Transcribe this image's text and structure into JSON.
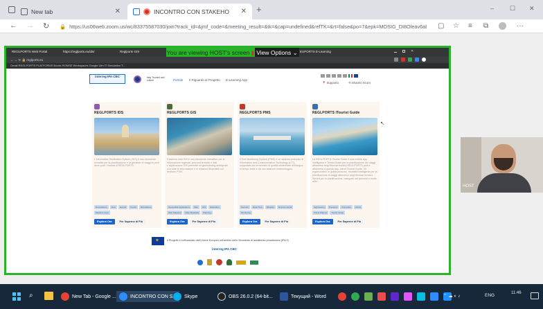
{
  "browser": {
    "tabs": [
      {
        "label": "New tab"
      },
      {
        "label": "INCONTRO CON STAKEHO"
      }
    ],
    "new_tab_symbol": "+",
    "window_controls": [
      "–",
      "☐",
      "✕"
    ],
    "url": "https://us06web.zoom.us/wc/83375587030/join?track_id=&jmf_code=&meeting_result=&tk=&cap=undefined&refTK=&rt=false&po=7&epk=MOSIG_DI8Oleav6abvgX05f..."
  },
  "meeting": {
    "banner_text": "You are viewing HOST's screen",
    "view_options_label": "View Options",
    "host_label": "HOST"
  },
  "shared": {
    "tabs": [
      {
        "label": "REGLPORTS Web Portal"
      },
      {
        "label": "https://reglports.eu/ids/"
      },
      {
        "label": "Reglports GIS"
      },
      {
        "label": "EUPORTS E-Learning"
      }
    ],
    "address": "reglports.eu",
    "bookmarks": "Gmail   REGLPORTS PLATFORMS   Books   ROMSE   Workspaces Google   Ulm IT Simulation T...",
    "site": {
      "logo_text": "interreg IPA CBC",
      "nav": [
        "Portale",
        "Il Riguardo al Progetto",
        "E-Learning App"
      ],
      "nav_prefix": "Italy Tourism and culture",
      "support": "Supporto",
      "share": "Sharelo Scorn",
      "cards": [
        {
          "title": "REGLPORTS IDS",
          "icon_color": "#8e5fa8",
          "desc": "L'Informative Destination System (IDS) è uno strumento versatile per la pianificazione e la gestione di viaggi in porti dove porti / marina di REGLPORTS.",
          "tags": [
            "Destinations",
            "Area",
            "Events",
            "Tourist",
            "Marinations",
            "Maritime Area"
          ],
          "primary_btn": "Esplora Ora",
          "secondary_btn": "Per Saperne di Più"
        },
        {
          "title": "REGLPORTS GIS",
          "icon_color": "#4a6b3a",
          "desc": "Il sistema web GIS è uno strumento interattivo per le informazioni regionali, percorsi tematici e dati. L'applicazione GIS permette un geoindexing ambiguale con tutte le informazioni e le relazioni disponibili sul territorio PSIV.",
          "tags": [
            "Geospatial Applications",
            "Map",
            "GIS",
            "Education",
            "Web Mapping",
            "Data Metadata",
            "Planning"
          ],
          "primary_btn": "Esplora Ora",
          "secondary_btn": "Per Saperne di Più"
        },
        {
          "title": "REGLPORTS PMS",
          "icon_color": "#c0392b",
          "desc": "Il Port Monitoring System (PMS) è un sistema avanzato di Information and Communication Technology (ICT), supportato da un servizio di qualità ambientale dell'acqua in tempo reale e da uno stazione meteorologica.",
          "tags": [
            "Sensors",
            "Real-Time",
            "Weather",
            "Environmental",
            "Monitoring"
          ],
          "primary_btn": "Esplora Ora",
          "secondary_btn": "Per Saperne di Più"
        },
        {
          "title": "REGLPORTS ITourist Guide",
          "icon_color": "#3b6fb0",
          "desc": "La REGLPORTS ITourist Guide è una mobile app intelligente e Tourist Guide per la pianificazione dei viaggi attraverso degli itinerari turistici REGLPORTS porti e attraverso a questa app, utenti ITourist Guide. Gli organizzatori, in guida possono, modalità intelligente per la pianificazione di viaggi attraverso degli itinerari turistici: Servizi per la pianificazione, categorie dei percorsi e molto altro.",
          "tags": [
            "Sightseeing",
            "Transport",
            "Itineraries",
            "Hotels",
            "Travel Planner",
            "Tourist Guide"
          ],
          "primary_btn": "Esplora Ora",
          "secondary_btn": "Per Saperne di Più"
        }
      ],
      "footer_text": "Il Progetto è cofinanziato dall'Unione Europea nell'ambito dello Strumento di assistenza preadesione (IPA II)",
      "footer_logo": "interreg IPA CBC"
    }
  },
  "taskbar": {
    "apps": [
      {
        "label": "New Tab - Google ..."
      },
      {
        "label": "INCONTRO CON S..."
      },
      {
        "label": "Skype"
      },
      {
        "label": "OBS 26.0.2 (64-bit..."
      },
      {
        "label": "Текущий - Word"
      }
    ],
    "lang": "ENG",
    "time": "11:46"
  },
  "colors": {
    "accent_green": "#2ab32a",
    "taskbar": "#16283a",
    "link_blue": "#1d64c9"
  }
}
